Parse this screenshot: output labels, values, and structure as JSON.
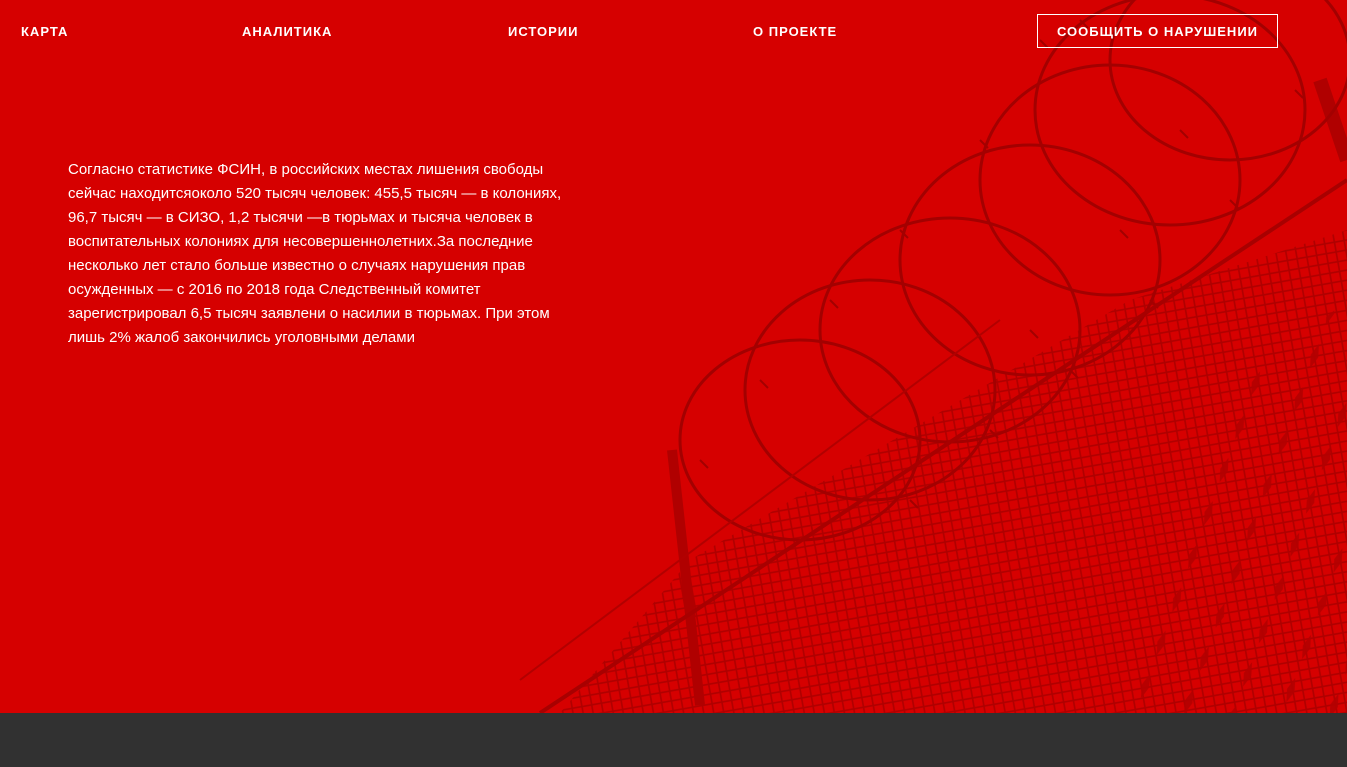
{
  "nav": {
    "items": [
      {
        "label": "КАРТА"
      },
      {
        "label": "АНАЛИТИКА"
      },
      {
        "label": "ИСТОРИИ"
      },
      {
        "label": "О ПРОЕКТЕ"
      }
    ],
    "report_button_label": "СООБЩИТЬ О НАРУШЕНИИ"
  },
  "hero": {
    "text": "Согласно статистике ФСИН, в российских местах лишения свободы сейчас находитсяоколо 520 тысяч человек: 455,5 тысяч — в колониях, 96,7 тысяч — в СИЗО, 1,2 тысячи —в тюрьмах и тысяча человек в воспитательных колониях для несовершеннолетних.За последние несколько лет стало больше известно о случаях нарушения прав осужденных — с 2016 по 2018 года Следственный комитет зарегистрировал 6,5 тысяч заявлени о насилии в тюрьмах. При этом лишь 2% жалоб закончились уголовными делами",
    "background_image": "barbed-wire-fence-photo"
  },
  "colors": {
    "hero_background": "#d60000",
    "footer_background": "#313131",
    "text": "#ffffff"
  }
}
